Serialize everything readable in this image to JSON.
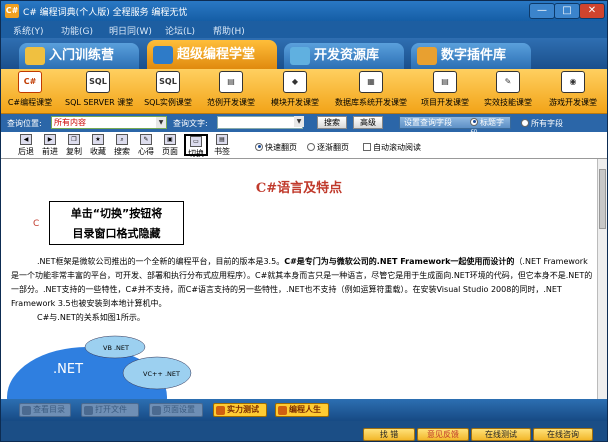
{
  "window": {
    "title": "C# 编程词典(个人版)  全程服务  编程无忧",
    "min": "—",
    "max": "□",
    "close": "✕",
    "app_icon": "C#"
  },
  "menu": [
    "系统(Y)",
    "功能(G)",
    "明日同(W)",
    "论坛(L)",
    "帮助(H)"
  ],
  "tabs": [
    "入门训练营",
    "超级编程学堂",
    "开发资源库",
    "数字插件库"
  ],
  "modules": [
    {
      "label": "C#编程课堂",
      "icon": "C#"
    },
    {
      "label": "SQL SERVER 课堂",
      "icon": "SQL"
    },
    {
      "label": "SQL实例课堂",
      "icon": "SQL"
    },
    {
      "label": "范例开发课堂",
      "icon": "▤"
    },
    {
      "label": "模块开发课堂",
      "icon": "◆"
    },
    {
      "label": "数据库系统开发课堂",
      "icon": "▦"
    },
    {
      "label": "项目开发课堂",
      "icon": "▤"
    },
    {
      "label": "实效技能课堂",
      "icon": "✎"
    },
    {
      "label": "游戏开发课堂",
      "icon": "◉"
    }
  ],
  "query": {
    "location_label": "查询位置:",
    "location_value": "所有内容",
    "text_label": "查询文字:",
    "text_value": "",
    "search_button": "搜索",
    "advanced_button": "高级",
    "settings_label": "设置查询字段",
    "opt_title": "标题字段",
    "opt_all": "所有字段"
  },
  "nav": {
    "buttons": [
      "后退",
      "前进",
      "复制",
      "收藏",
      "搜索",
      "心得",
      "页面",
      "切换",
      "书签"
    ],
    "icons": [
      "◀",
      "▶",
      "❐",
      "★",
      "⌕",
      "✎",
      "▣",
      "▭",
      "▤"
    ],
    "opt_fast": "快速翻页",
    "opt_step": "逐渐翻页",
    "opt_auto": "自动滚动阅读"
  },
  "document": {
    "title": "C#语言及特点",
    "para1_a": ".NET框架是微软公司推出的一个全新的编程平台，目前的版本是3.5。",
    "para1_b": "C#是专门为与微软公司的.NET Framework一起使用而设计的",
    "para1_c": "（.NET Framework是一个功能非常丰富的平台，可开发、部署和执行分布式应用程序）。C#就其本身而言只是一种语言，尽管它是用于生成面向.NET环境的代码，但它本身不是.NET的一部分。.NET支持的一些特性，C#并不支持，而C#语言支持的另一些特性，.NET也不支持（例如运算符重载）。在安装Visual Studio 2008的同时，.NET Framework 3.5也被安装到本地计算机中。",
    "para2": "C#与.NET的关系如图1所示。",
    "callout_line1": "单击“切换”按钮将",
    "callout_line2": "目录窗口格式隐藏",
    "diagram": {
      "outer": ".NET",
      "vb": "VB .NET",
      "vc": "VC++ .NET"
    }
  },
  "status_buttons": [
    "查看目录",
    "打开文件",
    "页面设置"
  ],
  "status_active": [
    "实力测试",
    "编程人生"
  ],
  "footer": [
    "找  错",
    "意见反馈",
    "在线测试",
    "在线咨询"
  ]
}
